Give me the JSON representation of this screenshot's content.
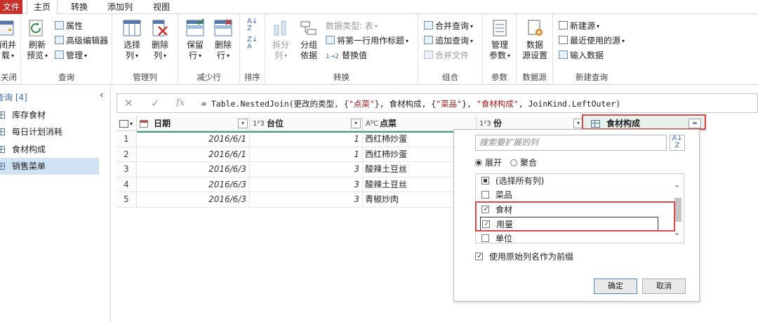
{
  "tabs": [
    {
      "label": "文件"
    },
    {
      "label": "主页"
    },
    {
      "label": "转换"
    },
    {
      "label": "添加列"
    },
    {
      "label": "视图"
    }
  ],
  "ribbon": {
    "close": {
      "btn_label_1": "闭并",
      "btn_label_2": "载",
      "group": "关闭"
    },
    "query": {
      "refresh_1": "刷新",
      "refresh_2": "预览",
      "properties": "属性",
      "advanced_editor": "高级编辑器",
      "manage": "管理",
      "group": "查询"
    },
    "manage_columns": {
      "choose_1": "选择",
      "choose_2": "列",
      "remove_1": "删除",
      "remove_2": "列",
      "group": "管理列"
    },
    "reduce_rows": {
      "keep_1": "保留",
      "keep_2": "行",
      "remove_1": "删除",
      "remove_2": "行",
      "group": "减少行"
    },
    "sort": {
      "group": "排序"
    },
    "transform": {
      "split_1": "拆分",
      "split_2": "列",
      "group_by_1": "分组",
      "group_by_2": "依据",
      "data_type": "数据类型: 表",
      "first_row_header": "将第一行用作标题",
      "replace_values": "替换值",
      "group": "转换"
    },
    "combine": {
      "merge_queries": "合并查询",
      "append_queries": "追加查询",
      "combine_files": "合并文件",
      "group": "组合"
    },
    "parameters": {
      "manage_1": "管理",
      "manage_2": "参数",
      "group": "参数"
    },
    "data_sources": {
      "settings_1": "数据",
      "settings_2": "源设置",
      "group": "数据源"
    },
    "new_query": {
      "new_source": "新建源",
      "recent_sources": "最近使用的源",
      "enter_data": "输入数据",
      "group": "新建查询"
    }
  },
  "queries": {
    "header": "查询 [4]",
    "items": [
      {
        "label": "库存食材"
      },
      {
        "label": "每日计划消耗"
      },
      {
        "label": "食材构成"
      },
      {
        "label": "销售菜单"
      }
    ]
  },
  "formula": {
    "prefix": "= Table.NestedJoin(更改的类型, {",
    "s1": "\"点菜\"",
    "mid1": "}, 食材构成, {",
    "s2": "\"菜品\"",
    "mid2": "}, ",
    "s3": "\"食材构成\"",
    "suffix": ", JoinKind.LeftOuter)"
  },
  "columns": [
    {
      "type_icon": "",
      "name": "日期"
    },
    {
      "type_icon": "1²3",
      "name": "台位"
    },
    {
      "type_icon": "AᴮC",
      "name": "点菜"
    },
    {
      "type_icon": "1²3",
      "name": "份"
    },
    {
      "type_icon": "",
      "name": "食材构成"
    }
  ],
  "rows": [
    {
      "n": "1",
      "date": "2016/6/1",
      "table": "1",
      "dish": "西红柿炒蛋"
    },
    {
      "n": "2",
      "date": "2016/6/1",
      "table": "1",
      "dish": "西红柿炒蛋"
    },
    {
      "n": "3",
      "date": "2016/6/3",
      "table": "3",
      "dish": "酸辣土豆丝"
    },
    {
      "n": "4",
      "date": "2016/6/3",
      "table": "3",
      "dish": "酸辣土豆丝"
    },
    {
      "n": "5",
      "date": "2016/6/3",
      "table": "3",
      "dish": "青椒炒肉"
    }
  ],
  "expand_popup": {
    "search_placeholder": "搜索要扩展的列",
    "mode_expand": "展开",
    "mode_aggregate": "聚合",
    "mode_selected": "expand",
    "columns": [
      {
        "label": "(选择所有列)",
        "state": "partial"
      },
      {
        "label": "菜品",
        "state": "unchecked"
      },
      {
        "label": "食材",
        "state": "checked"
      },
      {
        "label": "用量",
        "state": "checked"
      },
      {
        "label": "单位",
        "state": "unchecked"
      }
    ],
    "use_prefix_label": "使用原始列名作为前缀",
    "use_prefix_checked": true,
    "ok_label": "确定",
    "cancel_label": "取消"
  },
  "colors": {
    "file_tab": "#c8302a",
    "highlight": "#e04848",
    "selected_query": "#cfe3f5",
    "accent": "#36a37e"
  }
}
